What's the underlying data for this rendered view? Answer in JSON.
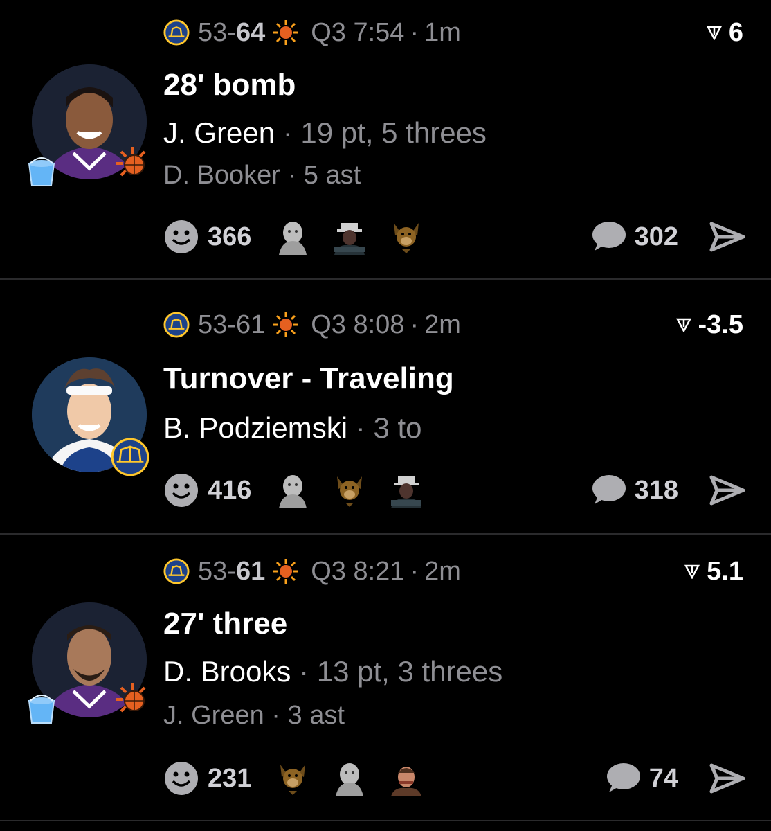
{
  "items": [
    {
      "team_a_score": "53",
      "team_b_score": "64",
      "period": "Q3 7:54",
      "age": "1m",
      "odds": "6",
      "headline": "28' bomb",
      "player": "J. Green",
      "player_stats": "19 pt, 5 threes",
      "assist_player": "D. Booker",
      "assist_stats": "5 ast",
      "reaction_count": "366",
      "comment_count": "302",
      "team": "suns",
      "reactors": [
        "baby-reactor-icon",
        "hat-man-reactor-icon",
        "dog-reactor-icon"
      ]
    },
    {
      "team_a_score": "53",
      "team_b_score": "61",
      "period": "Q3 8:08",
      "age": "2m",
      "odds": "-3.5",
      "headline": "Turnover - Traveling",
      "player": "B. Podziemski",
      "player_stats": "3 to",
      "reaction_count": "416",
      "comment_count": "318",
      "team": "warriors",
      "reactors": [
        "baby-reactor-icon",
        "dog-reactor-icon",
        "hat-man-reactor-icon"
      ]
    },
    {
      "team_a_score": "53",
      "team_b_score": "61",
      "period": "Q3 8:21",
      "age": "2m",
      "odds": "5.1",
      "headline": "27' three",
      "player": "D. Brooks",
      "player_stats": "13 pt, 3 threes",
      "assist_player": "J. Green",
      "assist_stats": "3 ast",
      "reaction_count": "231",
      "comment_count": "74",
      "team": "suns",
      "reactors": [
        "dog-reactor-icon",
        "baby-reactor-icon",
        "face-reactor-icon"
      ]
    }
  ],
  "separator": "·",
  "colors": {
    "background": "#000000",
    "muted": "#8e8e93",
    "divider": "#2a2a2c"
  }
}
